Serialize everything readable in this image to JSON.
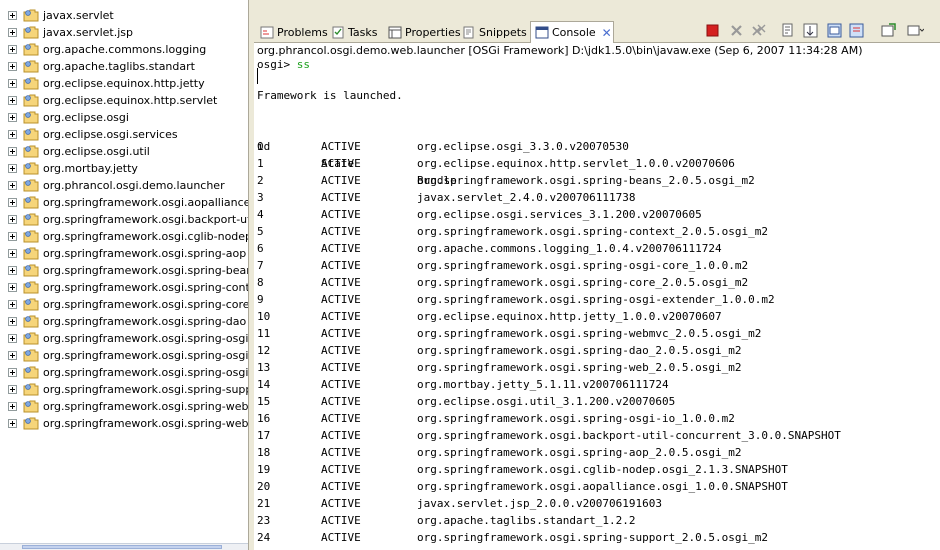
{
  "tree": {
    "items": [
      "javax.servlet",
      "javax.servlet.jsp",
      "org.apache.commons.logging",
      "org.apache.taglibs.standart",
      "org.eclipse.equinox.http.jetty",
      "org.eclipse.equinox.http.servlet",
      "org.eclipse.osgi",
      "org.eclipse.osgi.services",
      "org.eclipse.osgi.util",
      "org.mortbay.jetty",
      "org.phrancol.osgi.demo.launcher",
      "org.springframework.osgi.aopalliance.osgi",
      "org.springframework.osgi.backport-util-conc",
      "org.springframework.osgi.cglib-nodep.osgi",
      "org.springframework.osgi.spring-aop",
      "org.springframework.osgi.spring-beans",
      "org.springframework.osgi.spring-context",
      "org.springframework.osgi.spring-core",
      "org.springframework.osgi.spring-dao",
      "org.springframework.osgi.spring-osgi-core",
      "org.springframework.osgi.spring-osgi-exte",
      "org.springframework.osgi.spring-osgi-io",
      "org.springframework.osgi.spring-support",
      "org.springframework.osgi.spring-web",
      "org.springframework.osgi.spring-webmvc"
    ]
  },
  "tabs": [
    {
      "label": "Problems",
      "icon": "problems-icon"
    },
    {
      "label": "Tasks",
      "icon": "tasks-icon"
    },
    {
      "label": "Properties",
      "icon": "properties-icon"
    },
    {
      "label": "Snippets",
      "icon": "snippets-icon"
    },
    {
      "label": "Console",
      "icon": "console-icon",
      "active": true
    }
  ],
  "launch_title": "org.phrancol.osgi.demo.web.launcher [OSGi Framework] D:\\jdk1.5.0\\bin\\javaw.exe (Sep 6, 2007 11:34:28 AM)",
  "console": {
    "prompt": "osgi> ",
    "command": "ss",
    "message": "Framework is launched.",
    "headers": {
      "id": "id",
      "state": "State",
      "bundle": "Bundle"
    },
    "rows": [
      [
        "0",
        "ACTIVE",
        "org.eclipse.osgi_3.3.0.v20070530"
      ],
      [
        "1",
        "ACTIVE",
        "org.eclipse.equinox.http.servlet_1.0.0.v20070606"
      ],
      [
        "2",
        "ACTIVE",
        "org.springframework.osgi.spring-beans_2.0.5.osgi_m2"
      ],
      [
        "3",
        "ACTIVE",
        "javax.servlet_2.4.0.v200706111738"
      ],
      [
        "4",
        "ACTIVE",
        "org.eclipse.osgi.services_3.1.200.v20070605"
      ],
      [
        "5",
        "ACTIVE",
        "org.springframework.osgi.spring-context_2.0.5.osgi_m2"
      ],
      [
        "6",
        "ACTIVE",
        "org.apache.commons.logging_1.0.4.v200706111724"
      ],
      [
        "7",
        "ACTIVE",
        "org.springframework.osgi.spring-osgi-core_1.0.0.m2"
      ],
      [
        "8",
        "ACTIVE",
        "org.springframework.osgi.spring-core_2.0.5.osgi_m2"
      ],
      [
        "9",
        "ACTIVE",
        "org.springframework.osgi.spring-osgi-extender_1.0.0.m2"
      ],
      [
        "10",
        "ACTIVE",
        "org.eclipse.equinox.http.jetty_1.0.0.v20070607"
      ],
      [
        "11",
        "ACTIVE",
        "org.springframework.osgi.spring-webmvc_2.0.5.osgi_m2"
      ],
      [
        "12",
        "ACTIVE",
        "org.springframework.osgi.spring-dao_2.0.5.osgi_m2"
      ],
      [
        "13",
        "ACTIVE",
        "org.springframework.osgi.spring-web_2.0.5.osgi_m2"
      ],
      [
        "14",
        "ACTIVE",
        "org.mortbay.jetty_5.1.11.v200706111724"
      ],
      [
        "15",
        "ACTIVE",
        "org.eclipse.osgi.util_3.1.200.v20070605"
      ],
      [
        "16",
        "ACTIVE",
        "org.springframework.osgi.spring-osgi-io_1.0.0.m2"
      ],
      [
        "17",
        "ACTIVE",
        "org.springframework.osgi.backport-util-concurrent_3.0.0.SNAPSHOT"
      ],
      [
        "18",
        "ACTIVE",
        "org.springframework.osgi.spring-aop_2.0.5.osgi_m2"
      ],
      [
        "19",
        "ACTIVE",
        "org.springframework.osgi.cglib-nodep.osgi_2.1.3.SNAPSHOT"
      ],
      [
        "20",
        "ACTIVE",
        "org.springframework.osgi.aopalliance.osgi_1.0.0.SNAPSHOT"
      ],
      [
        "21",
        "ACTIVE",
        "javax.servlet.jsp_2.0.0.v200706191603"
      ],
      [
        "23",
        "ACTIVE",
        "org.apache.taglibs.standart_1.2.2"
      ],
      [
        "24",
        "ACTIVE",
        "org.springframework.osgi.spring-support_2.0.5.osgi_m2"
      ]
    ]
  },
  "colors": {
    "command": "#1b9f1b",
    "terminate": "#d42020",
    "tab_close": "#4a6ed0"
  }
}
